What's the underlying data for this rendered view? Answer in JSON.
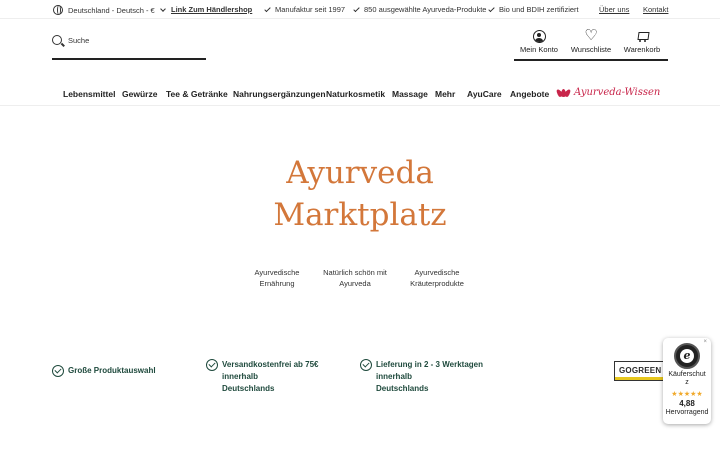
{
  "topbar": {
    "locale": "Deutschland - Deutsch - €",
    "dealer_link": "Link Zum Händlershop",
    "claims": [
      "Manufaktur seit 1997",
      "850 ausgewählte Ayurveda-Produkte",
      "Bio und BDIH zertifiziert"
    ],
    "about": "Über uns",
    "contact": "Kontakt"
  },
  "header": {
    "search_placeholder": "Suche",
    "account": "Mein Konto",
    "wishlist": "Wunschliste",
    "cart": "Warenkorb"
  },
  "nav": {
    "items": [
      "Lebensmittel",
      "Gewürze",
      "Tee & Getränke",
      "Nahrungsergänzungen",
      "Naturkosmetik",
      "Massage",
      "Mehr",
      "AyuCare",
      "Angebote"
    ],
    "wissen": "Ayurveda-Wissen",
    "wissen_color": "#c8254a"
  },
  "hero": {
    "title_line1": "Ayurveda",
    "title_line2": "Marktplatz",
    "title_color": "#d3773a",
    "categories": [
      {
        "line1": "Ayurvedische",
        "line2": "Ernährung"
      },
      {
        "line1": "Natürlich schön mit",
        "line2": "Ayurveda"
      },
      {
        "line1": "Ayurvedische",
        "line2": "Kräuterprodukte"
      }
    ]
  },
  "usps": [
    {
      "line1": "Große Produktauswahl",
      "line2": ""
    },
    {
      "line1": "Versandkostenfrei ab 75€ innerhalb",
      "line2": "Deutschlands"
    },
    {
      "line1": "Lieferung in 2 - 3 Werktagen innerhalb",
      "line2": "Deutschlands"
    }
  ],
  "usp_color": "#1f4a3d",
  "gogreen": "GOGREEN",
  "badge": {
    "seal_letter": "e",
    "title_line1": "Käuferschut",
    "title_line2": "z",
    "stars": "★★★★★",
    "rating": "4,88",
    "label": "Hervorragend",
    "close": "×"
  }
}
